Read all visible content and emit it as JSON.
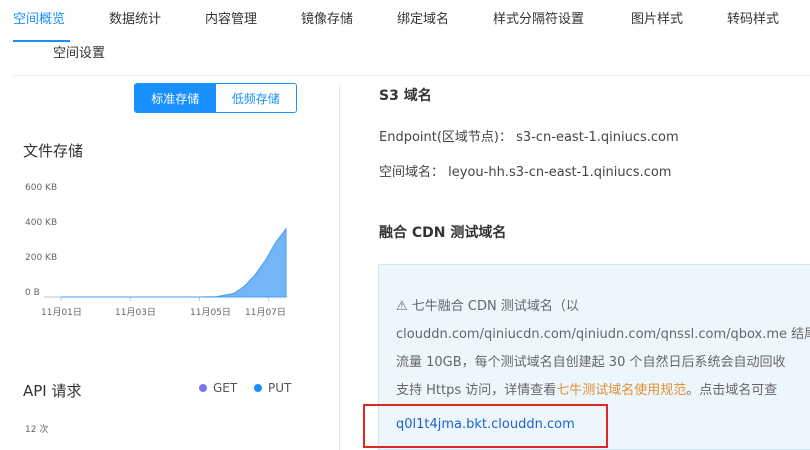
{
  "tabs": [
    {
      "label": "空间概览",
      "active": true
    },
    {
      "label": "数据统计"
    },
    {
      "label": "内容管理"
    },
    {
      "label": "镜像存储"
    },
    {
      "label": "绑定域名"
    },
    {
      "label": "样式分隔符设置"
    },
    {
      "label": "图片样式"
    },
    {
      "label": "转码样式"
    },
    {
      "label": "空间设置"
    }
  ],
  "storage_toggle": {
    "standard": "标准存储",
    "infrequent": "低频存储",
    "selected": "标准存储"
  },
  "file_storage": {
    "title": "文件存储",
    "chart_data": {
      "type": "area",
      "title": "文件存储",
      "y_ticks": [
        "600 KB",
        "400 KB",
        "200 KB",
        "0 B"
      ],
      "ylim": [
        0,
        600
      ],
      "x_ticks": [
        "11月01日",
        "11月03日",
        "11月05日",
        "11月07日"
      ],
      "x_days": [
        1,
        2,
        3,
        4,
        5,
        5.5,
        6,
        6.3,
        6.6,
        6.9,
        7.2,
        7.5
      ],
      "values_kb": [
        0,
        0,
        0,
        0,
        0,
        2,
        20,
        60,
        120,
        200,
        300,
        375
      ],
      "color": "#5aa9f5"
    }
  },
  "api_requests": {
    "title": "API 请求",
    "legend": [
      {
        "name": "GET",
        "color": "#7b74ee"
      },
      {
        "name": "PUT",
        "color": "#1890ff"
      }
    ],
    "y_top_tick": "12 次"
  },
  "s3": {
    "title": "S3 域名",
    "endpoint_label": "Endpoint(区域节点)：",
    "endpoint_value": "s3-cn-east-1.qiniucs.com",
    "space_domain_label": "空间域名：",
    "space_domain_value": "leyou-hh.s3-cn-east-1.qiniucs.com"
  },
  "cdn": {
    "title": "融合 CDN 测试域名",
    "line1": "⚠ 七牛融合 CDN 测试域名（以",
    "line2": "clouddn.com/qiniucdn.com/qiniudn.com/qnssl.com/qbox.me 结尾",
    "line3": "流量 10GB，每个测试域名自创建起 30 个自然日后系统会自动回收",
    "line4_prefix": "支持 Https 访问，详情查看",
    "line4_link": "七牛测试域名使用规范",
    "line4_suffix": "。点击域名可查",
    "domain": "q0l1t4jma.bkt.clouddn.com"
  }
}
